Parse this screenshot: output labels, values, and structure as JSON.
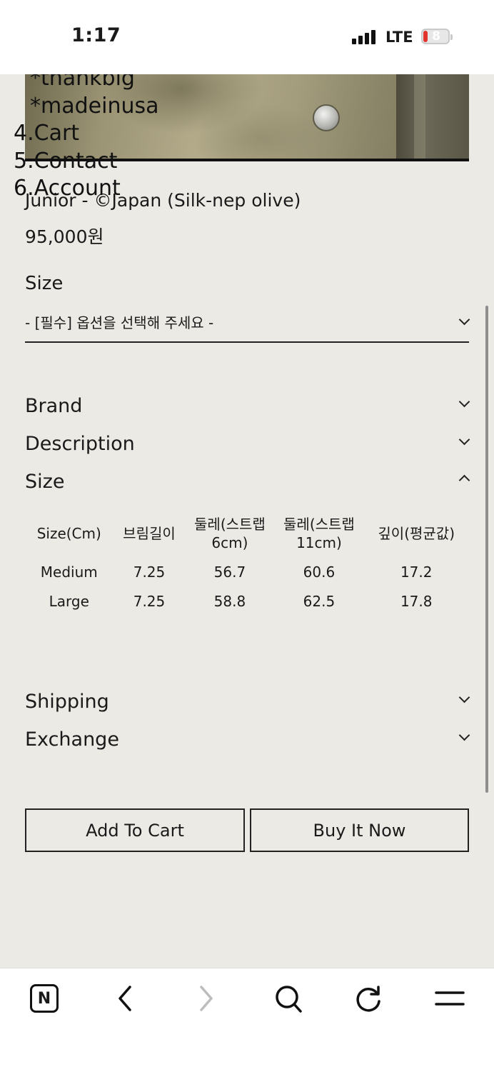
{
  "status_bar": {
    "time": "1:17",
    "network": "LTE",
    "battery": "8"
  },
  "overlay_menu": {
    "items": [
      "*thankbig",
      "*madeinusa",
      "4.Cart",
      "5.Contact",
      "6.Account"
    ]
  },
  "product": {
    "title": "Junior - ©Japan (Silk-nep olive)",
    "price": "95,000원",
    "option": {
      "label": "Size",
      "selected": "- [필수] 옵션을 선택해 주세요 -"
    }
  },
  "accordion": {
    "brand": "Brand",
    "description": "Description",
    "size": "Size",
    "shipping": "Shipping",
    "exchange": "Exchange"
  },
  "size_table": {
    "headers": [
      "Size(Cm)",
      "브림길이",
      "둘레(스트랩 6cm)",
      "둘레(스트랩 11cm)",
      "깊이(평균값)"
    ],
    "rows": [
      [
        "Medium",
        "7.25",
        "56.7",
        "60.6",
        "17.2"
      ],
      [
        "Large",
        "7.25",
        "58.8",
        "62.5",
        "17.8"
      ]
    ]
  },
  "actions": {
    "add_to_cart": "Add To Cart",
    "buy_now": "Buy It Now"
  },
  "browser_bar": {
    "logo": "N"
  }
}
